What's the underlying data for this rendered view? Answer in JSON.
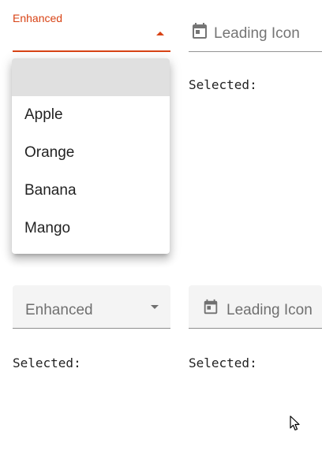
{
  "top_left_select": {
    "label": "Enhanced",
    "value": ""
  },
  "top_right_select": {
    "label": "Leading Icon",
    "icon": "calendar-icon",
    "selected_text": "Selected:"
  },
  "menu": {
    "items": [
      {
        "label": ""
      },
      {
        "label": "Apple"
      },
      {
        "label": "Orange"
      },
      {
        "label": "Banana"
      },
      {
        "label": "Mango"
      }
    ]
  },
  "bottom_left_select": {
    "label": "Enhanced",
    "selected_text": "Selected:"
  },
  "bottom_right_select": {
    "label": "Leading Icon",
    "icon": "calendar-icon",
    "selected_text": "Selected:"
  },
  "colors": {
    "accent": "#d84315",
    "filled_bg": "#f4f4f4",
    "menu_selected_bg": "#e0e0e0"
  }
}
